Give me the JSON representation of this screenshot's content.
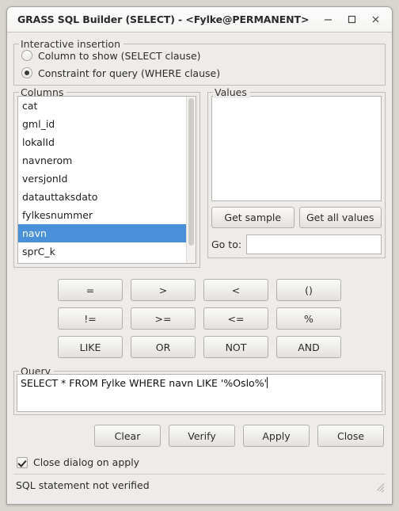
{
  "window": {
    "title": "GRASS SQL Builder (SELECT) - <Fylke@PERMANENT>",
    "minimize_label": "minimize",
    "maximize_label": "maximize",
    "close_label": "close"
  },
  "interactive_insertion": {
    "group_title": "Interactive insertion",
    "options": [
      {
        "label": "Column to show (SELECT clause)",
        "checked": false
      },
      {
        "label": "Constraint for query (WHERE clause)",
        "checked": true
      }
    ]
  },
  "columns": {
    "group_title": "Columns",
    "items": [
      "cat",
      "gml_id",
      "lokalId",
      "navnerom",
      "versjonId",
      "datauttaksdato",
      "fylkesnummer",
      "navn",
      "sprC_k"
    ],
    "selected": "navn"
  },
  "values": {
    "group_title": "Values",
    "items": [],
    "get_sample_label": "Get sample",
    "get_all_values_label": "Get all values",
    "goto_label": "Go to:",
    "goto_value": ""
  },
  "operators": [
    "=",
    ">",
    "<",
    "()",
    "!=",
    ">=",
    "<=",
    "%",
    "LIKE",
    "OR",
    "NOT",
    "AND"
  ],
  "query": {
    "group_title": "Query",
    "text": "SELECT * FROM Fylke WHERE navn LIKE '%Oslo%'"
  },
  "actions": [
    "Clear",
    "Verify",
    "Apply",
    "Close"
  ],
  "close_on_apply": {
    "label": "Close dialog on apply",
    "checked": true
  },
  "status": {
    "text": "SQL statement not verified"
  },
  "colors": {
    "selection": "#4a90d9",
    "window_bg": "#edecea",
    "field_bg": "#ffffff",
    "border": "#b6b3ad"
  }
}
